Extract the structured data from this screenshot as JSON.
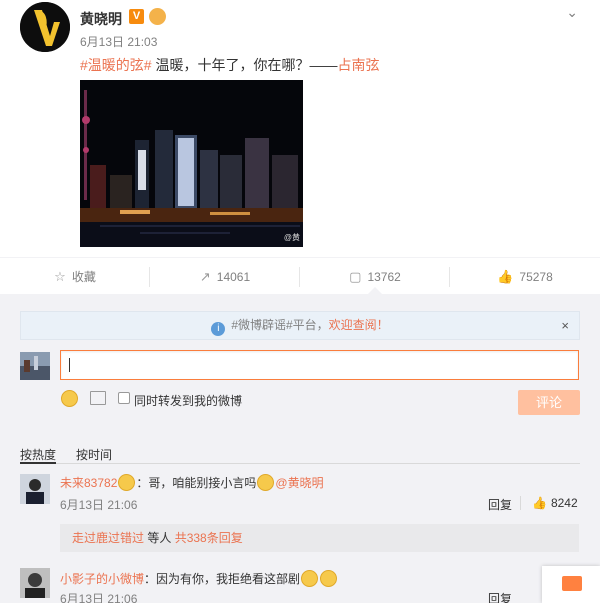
{
  "post": {
    "username": "黄晓明",
    "v_badge": "V",
    "time": "6月13日 21:03",
    "topic": "#温暖的弦#",
    "text": " 温暖，十年了，你在哪？——",
    "mention": "占南弦",
    "watermark": "@黄"
  },
  "actions": {
    "favorite_label": "收藏",
    "repost_count": "14061",
    "comment_count": "13762",
    "like_count": "75278"
  },
  "comment_area": {
    "notice_prefix": "#微博辟谣#平台，",
    "notice_link": "欢迎查阅！",
    "notice_close": "×",
    "input_value": "",
    "sync_label": "同时转发到我的微博",
    "submit_label": "评论"
  },
  "sort_tabs": [
    "按热度",
    "按时间"
  ],
  "comments": [
    {
      "name": "未来83782",
      "text": "：哥，咱能别接小言吗",
      "mention": "@黄晓明",
      "time": "6月13日 21:06",
      "reply_label": "回复",
      "likes": "8242",
      "sub_reply_link": "走过鹿过错过",
      "sub_reply_mid": " 等人 ",
      "sub_reply_count": "共338条回复"
    },
    {
      "name": "小影子的小微博",
      "text": "：因为有你，我拒绝看这部剧",
      "time": "6月13日 21:06",
      "reply_label": "回复"
    }
  ],
  "colors": {
    "accent": "#eb7350",
    "button_orange": "#ffc09f",
    "badge_orange": "#f78b0e"
  },
  "icons": [
    "chevron-down-icon",
    "star-icon",
    "repost-icon",
    "comment-icon",
    "thumbs-up-icon",
    "info-icon",
    "emoji-icon",
    "image-icon",
    "message-icon"
  ]
}
